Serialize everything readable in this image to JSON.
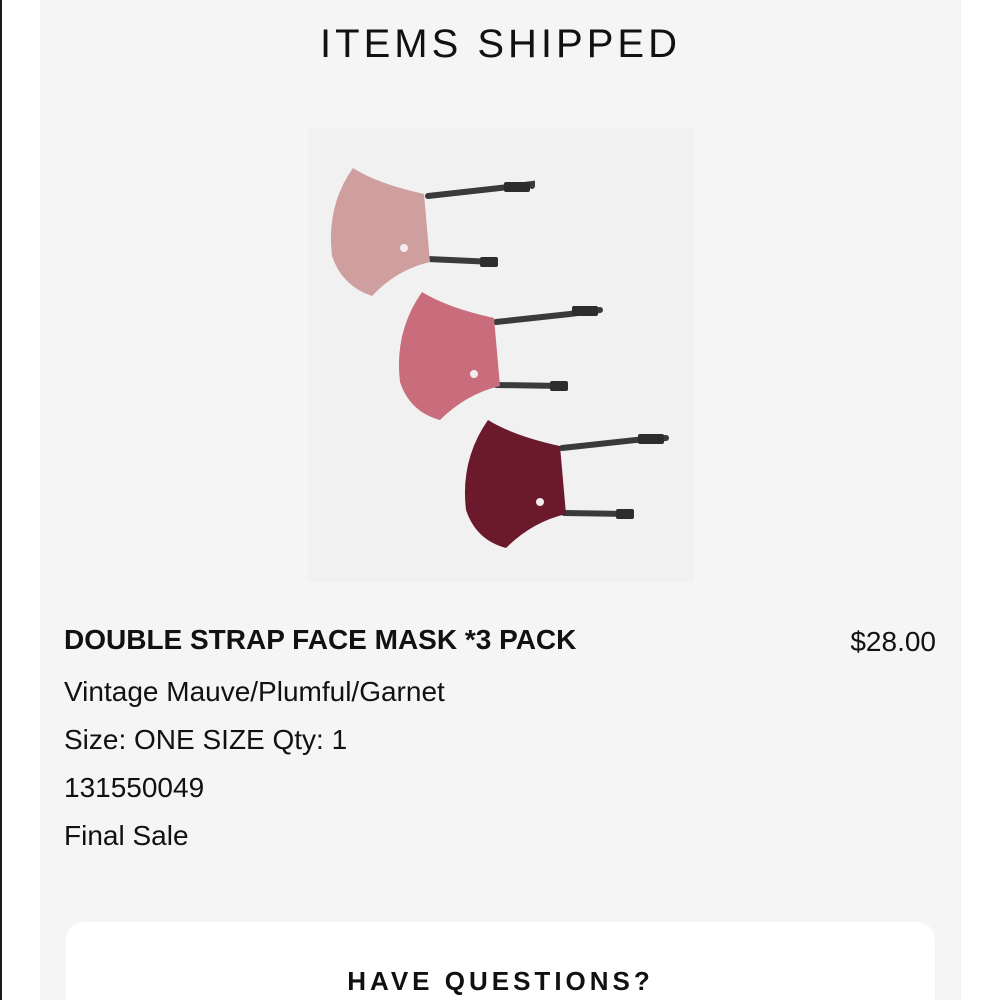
{
  "section": {
    "title": "ITEMS SHIPPED"
  },
  "item": {
    "name": "DOUBLE STRAP FACE MASK *3 PACK",
    "price": "$28.00",
    "color": "Vintage Mauve/Plumful/Garnet",
    "size_qty": "Size: ONE SIZE Qty: 1",
    "sku": "131550049",
    "sale_note": "Final Sale",
    "image_icon": "face-mask-product-photo",
    "mask_colors": [
      "#cf9e9f",
      "#c96d7d",
      "#6b1a2b"
    ],
    "strap_color": "#3a3a3a"
  },
  "questions": {
    "title": "HAVE QUESTIONS?"
  }
}
